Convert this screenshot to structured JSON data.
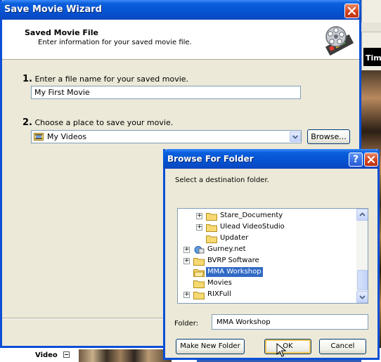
{
  "background": {
    "timeline_header": "Tim",
    "track_label": "Video"
  },
  "wizard": {
    "title": "Save Movie Wizard",
    "header_title": "Saved Movie File",
    "header_subtitle": "Enter information for your saved movie file.",
    "step1": {
      "number": "1.",
      "label": "Enter a file name for your saved movie.",
      "value": "My First Movie"
    },
    "step2": {
      "number": "2.",
      "label": "Choose a place to save your movie.",
      "value": "My Videos"
    },
    "browse_label": "Browse..."
  },
  "browse_dialog": {
    "title": "Browse For Folder",
    "help_glyph": "?",
    "instruction": "Select a destination folder.",
    "tree": [
      {
        "label": "Stare_Documenty",
        "expander": "+",
        "icon": "folder-icon"
      },
      {
        "label": "Ulead VideoStudio",
        "expander": "+",
        "icon": "folder-icon"
      },
      {
        "label": "Updater",
        "expander": "",
        "icon": "folder-icon"
      },
      {
        "label": "Gurney.net",
        "expander": "+",
        "icon": "network-folder-icon"
      },
      {
        "label": "BVRP Software",
        "expander": "+",
        "icon": "folder-icon"
      },
      {
        "label": "MMA Workshop",
        "expander": "",
        "icon": "folder-icon",
        "selected": true
      },
      {
        "label": "Movies",
        "expander": "",
        "icon": "folder-icon"
      },
      {
        "label": "RIXFull",
        "expander": "+",
        "icon": "folder-icon"
      }
    ],
    "folder_label": "Folder:",
    "folder_value": "MMA Workshop",
    "make_folder_label": "Make New Folder",
    "ok_label": "OK",
    "cancel_label": "Cancel"
  },
  "colors": {
    "titlebar": "#0553d1",
    "selection": "#316ac5",
    "dialog_face": "#ece9d8"
  }
}
